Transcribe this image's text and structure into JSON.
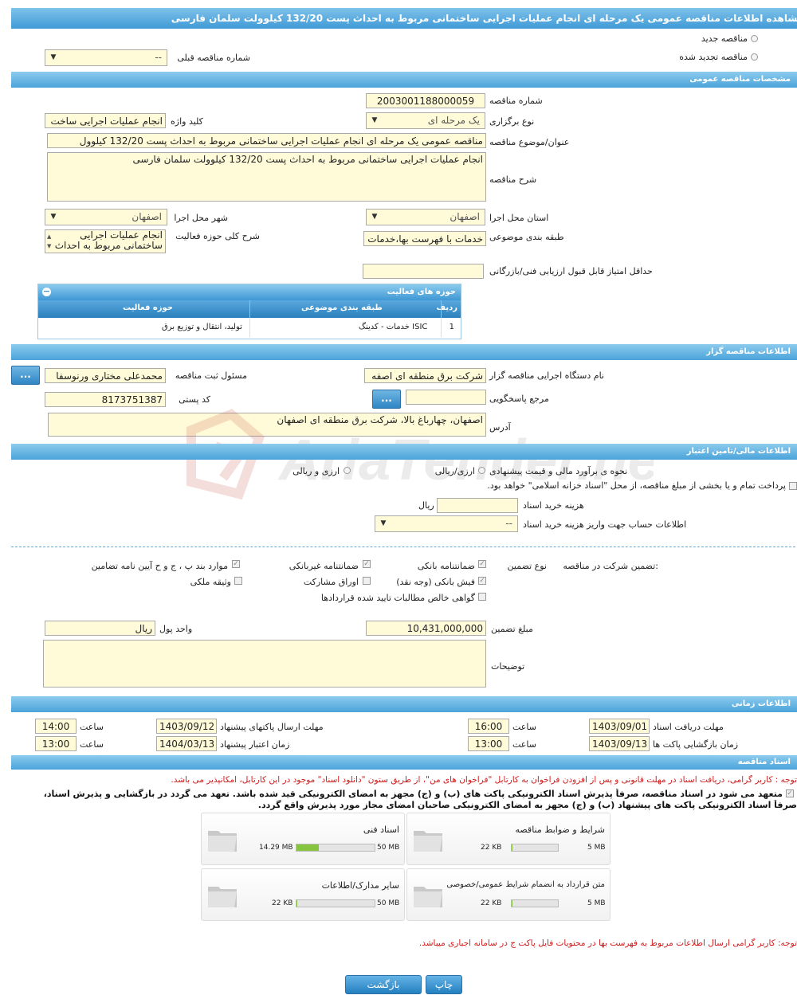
{
  "title": "مشاهده اطلاعات مناقصه عمومی یک مرحله ای انجام عملیات اجرایی ساختمانی مربوط به احداث پست 132/20 کیلوولت سلمان فارسی",
  "top": {
    "radio_new": "مناقصه جدید",
    "radio_renewed": "مناقصه تجدید شده",
    "prev_label": "شماره مناقصه قبلی",
    "prev_value": "--"
  },
  "sections": {
    "general": "مشخصات مناقصه عمومی",
    "organizer": "اطلاعات مناقصه گزار",
    "financial": "اطلاعات مالی/تامین اعتبار",
    "timing": "اطلاعات زمانی",
    "documents": "اسناد مناقصه"
  },
  "general": {
    "number_label": "شماره مناقصه",
    "number_value": "2003001188000059",
    "type_label": "نوع برگزاری",
    "type_value": "یک مرحله ای",
    "keyword_label": "کلید واژه",
    "keyword_value": "انجام عملیات اجرایی ساخت",
    "subject_label": "عنوان/موضوع مناقصه",
    "subject_value": "مناقصه عمومی یک مرحله ای انجام عملیات اجرایی ساختمانی مربوط به احداث پست 132/20 کیلوول",
    "desc_label": "شرح مناقصه",
    "desc_value": "انجام عملیات اجرایی ساختمانی مربوط به احداث پست 132/20 کیلوولت سلمان فارسی",
    "province_label": "استان محل اجرا",
    "province_value": "اصفهان",
    "city_label": "شهر محل اجرا",
    "city_value": "اصفهان",
    "category_label": "طبقه بندی موضوعی",
    "category_value": "خدمات با فهرست بها،خدمات",
    "scope_label": "شرح کلی حوزه فعالیت",
    "scope_line1": "انجام عملیات اجرایی",
    "scope_line2": "ساختمانی مربوط به احداث",
    "min_score_label": "حداقل امتیاز قابل قبول ارزیابی فنی/بازرگانی",
    "min_score_value": ""
  },
  "activity_table": {
    "title": "حوزه های فعالیت",
    "headers": [
      "ردیف",
      "طبقه بندی موضوعی",
      "حوزه فعالیت"
    ],
    "rows": [
      {
        "index": "1",
        "category": "خدمات - کدینگ ISIC",
        "field": "تولید، انتقال و توزیع برق"
      }
    ]
  },
  "organizer": {
    "org_label": "نام دستگاه اجرایی مناقصه گزار",
    "org_value": "شرکت برق منطقه ای اصفه",
    "registrar_label": "مسئول ثبت مناقصه",
    "registrar_value": "محمدعلی مختاری ورنوسفا",
    "registrar_btn": "...",
    "ref_label": "مرجع پاسخگویی",
    "ref_value": "",
    "ref_btn": "...",
    "postal_label": "کد پستی",
    "postal_value": "8173751387",
    "address_label": "آدرس",
    "address_value": "اصفهان، چهارباغ بالا، شرکت برق منطقه ای اصفهان"
  },
  "financial": {
    "estimate_label": "نحوه ی برآورد مالی و قیمت پیشنهادی",
    "opt_rial": "ارزی/ریالی",
    "opt_fx": "ارزی و ریالی",
    "treasury_text": "پرداخت تمام و یا بخشی از مبلغ مناقصه، از محل \"اسناد خزانه اسلامی\" خواهد بود.",
    "doc_cost_label": "هزینه خرید اسناد",
    "doc_cost_value": "",
    "doc_cost_unit": "ریال",
    "account_label": "اطلاعات حساب جهت واریز هزینه خرید اسناد",
    "account_value": "--"
  },
  "guarantee": {
    "label": "تضمین شرکت در مناقصه:",
    "type_label": "نوع تضمین",
    "options": [
      {
        "label": "ضمانتنامه بانکی",
        "checked": true
      },
      {
        "label": "ضمانتنامه غیربانکی",
        "checked": true
      },
      {
        "label": "موارد بند پ ، ج و ح آیین نامه تضامین",
        "checked": true
      },
      {
        "label": "فیش بانکی (وجه نقد)",
        "checked": true
      },
      {
        "label": "اوراق مشارکت",
        "checked": false
      },
      {
        "label": "وثیقه ملکی",
        "checked": false
      },
      {
        "label": "گواهی خالص مطالبات تایید شده قراردادها",
        "checked": false
      }
    ],
    "amount_label": "مبلغ تضمین",
    "amount_value": "10,431,000,000",
    "currency_label": "واحد پول",
    "currency_value": "ریال",
    "notes_label": "توضیحات",
    "notes_value": ""
  },
  "timing": {
    "receive_label": "مهلت دریافت اسناد",
    "receive_date": "1403/09/01",
    "receive_time": "16:00",
    "send_label": "مهلت ارسال پاکتهای پیشنهاد",
    "send_date": "1403/09/12",
    "send_time": "14:00",
    "open_label": "زمان بازگشایی پاکت ها",
    "open_date": "1403/09/13",
    "open_time": "13:00",
    "validity_label": "زمان اعتبار پیشنهاد",
    "validity_date": "1404/03/13",
    "validity_time": "13:00",
    "time_label": "ساعت"
  },
  "documents": {
    "notice": "توجه : کاربر گرامی، دریافت اسناد در مهلت قانونی و پس از افزودن فراخوان به کارتابل \"فراخوان های من\"، از طریق ستون \"دانلود اسناد\" موجود در این کارتابل، امکانپذیر می باشد.",
    "commit_line1": "متعهد می شود در اسناد مناقصه، صرفاً پذیرش اسناد الکترونیکی پاکت های (ب) و (ج) مجهز به امضای الکترونیکی قید شده باشد. تعهد می گردد در بازگشایی و پذیرش اسناد،",
    "commit_line2": "صرفاً اسناد الکترونیکی پاکت های پیشنهاد (ب) و (ج) مجهز به امضای الکترونیکی صاحبان امضای مجاز مورد پذیرش واقع گردد.",
    "files": [
      {
        "name": "شرایط و ضوابط مناقصه",
        "size": "22 KB",
        "max": "5 MB",
        "fill": 0.01
      },
      {
        "name": "اسناد فنی",
        "size": "14.29 MB",
        "max": "50 MB",
        "fill": 0.29
      },
      {
        "name": "متن قرارداد به انضمام شرایط عمومی/خصوصی",
        "size": "22 KB",
        "max": "5 MB",
        "fill": 0.01
      },
      {
        "name": "سایر مدارک/اطلاعات",
        "size": "22 KB",
        "max": "50 MB",
        "fill": 0.01
      }
    ],
    "footer_note": "توجه: کاربر گرامی ارسال اطلاعات مربوط به فهرست بها در محتویات فایل پاکت ج در سامانه اجباری میباشد."
  },
  "buttons": {
    "print": "چاپ",
    "back": "بازگشت"
  },
  "watermark": "AriaTender.neT"
}
